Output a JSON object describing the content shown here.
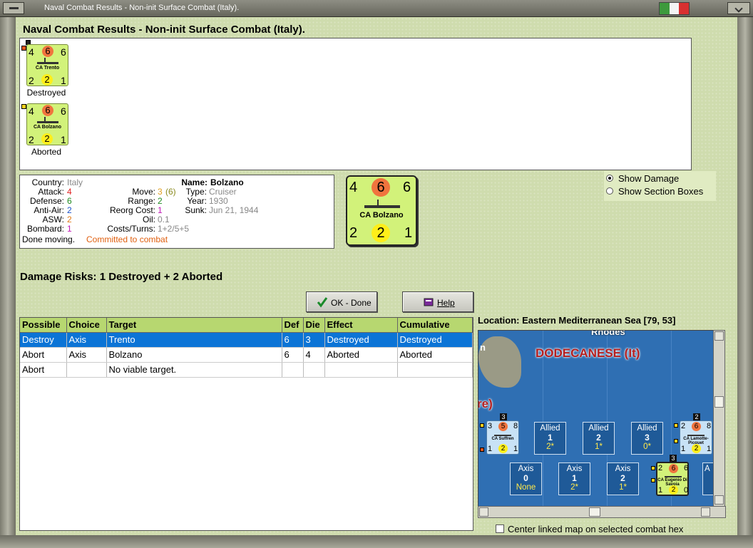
{
  "window": {
    "title": "Naval Combat Results - Non-init Surface Combat (Italy).",
    "flag_colors": [
      "#3d9a3d",
      "#f4f4f4",
      "#d83030"
    ]
  },
  "heading": "Naval Combat Results - Non-init Surface Combat (Italy).",
  "units": [
    {
      "attack": "4",
      "defense": "6",
      "move": "6",
      "anti_air": "2",
      "asw": "2",
      "bombard": "1",
      "name": "CA Trento",
      "status": "Destroyed",
      "marker_color": "#e0551b"
    },
    {
      "attack": "4",
      "defense": "6",
      "move": "6",
      "anti_air": "2",
      "asw": "2",
      "bombard": "1",
      "name": "CA Bolzano",
      "status": "Aborted",
      "marker_color": "#ffd21e"
    }
  ],
  "info": {
    "country_label": "Country:",
    "country": "Italy",
    "attack_label": "Attack:",
    "attack": "4",
    "defense_label": "Defense:",
    "defense": "6",
    "anti_air_label": "Anti-Air:",
    "anti_air": "2",
    "asw_label": "ASW:",
    "asw": "2",
    "bombard_label": "Bombard:",
    "bombard": "1",
    "name_label": "Name:",
    "name": "Bolzano",
    "move_label": "Move:",
    "move": "3",
    "move_extra": "(6)",
    "range_label": "Range:",
    "range": "2",
    "reorg_label": "Reorg Cost:",
    "reorg": "1",
    "oil_label": "Oil:",
    "oil": "0.1",
    "costs_label": "Costs/Turns:",
    "costs": "1+2/5+5",
    "type_label": "Type:",
    "type": "Cruiser",
    "year_label": "Year:",
    "year": "1930",
    "sunk_label": "Sunk:",
    "sunk": "Jun 21, 1944",
    "done_moving": "Done moving.",
    "committed": "Committed to combat"
  },
  "big_counter": {
    "attack": "4",
    "defense": "6",
    "move": "6",
    "anti_air": "2",
    "asw": "2",
    "bombard": "1",
    "name": "CA Bolzano"
  },
  "options": {
    "show_damage": "Show Damage",
    "show_sections": "Show Section Boxes",
    "selected": "show_damage"
  },
  "damage_risks": "Damage Risks:  1 Destroyed + 2 Aborted",
  "buttons": {
    "ok": "OK - Done",
    "help": "Help"
  },
  "table": {
    "headers": [
      "Possible",
      "Choice",
      "Target",
      "Def",
      "Die",
      "Effect",
      "Cumulative"
    ],
    "rows": [
      [
        "Destroy",
        "Axis",
        "Trento",
        "6",
        "3",
        "Destroyed",
        "Destroyed"
      ],
      [
        "Abort",
        "Axis",
        "Bolzano",
        "6",
        "4",
        "Aborted",
        "Aborted"
      ],
      [
        "Abort",
        "",
        "No viable target.",
        "",
        "",
        "",
        ""
      ]
    ],
    "selected_row": 0
  },
  "location": "Location:  Eastern Mediterranean Sea [79, 53]",
  "map": {
    "region": "DODECANESE (It)",
    "top_label": "Rhodes",
    "left_partial": "re)",
    "left_partial_top": "n",
    "allied_boxes": [
      {
        "label": "Allied",
        "value": "1",
        "sub": "2*"
      },
      {
        "label": "Allied",
        "value": "2",
        "sub": "1*"
      },
      {
        "label": "Allied",
        "value": "3",
        "sub": "0*"
      }
    ],
    "axis_boxes": [
      {
        "label": "Axis",
        "value": "0",
        "sub": "None"
      },
      {
        "label": "Axis",
        "value": "1",
        "sub": "2*"
      },
      {
        "label": "Axis",
        "value": "2",
        "sub": "1*"
      }
    ],
    "partial_box_label": "A",
    "map_units": [
      {
        "count": "3",
        "attack": "3",
        "defense": "5",
        "move": "8",
        "bottom_left": "1",
        "bottom_mid": "2",
        "bottom_right": "1",
        "name": "CA Suffren"
      },
      {
        "count": "2",
        "attack": "2",
        "defense": "6",
        "move": "8",
        "bottom_left": "1",
        "bottom_mid": "2",
        "bottom_right": "1",
        "name": "CA Lamotte-Picquet"
      },
      {
        "count": "3",
        "attack": "2",
        "defense": "6",
        "move": "6",
        "bottom_left": "1",
        "bottom_mid": "2",
        "bottom_right": "0",
        "name": "CA Eugenio Di Savoia"
      }
    ]
  },
  "center_check": "Center linked map on selected combat hex"
}
